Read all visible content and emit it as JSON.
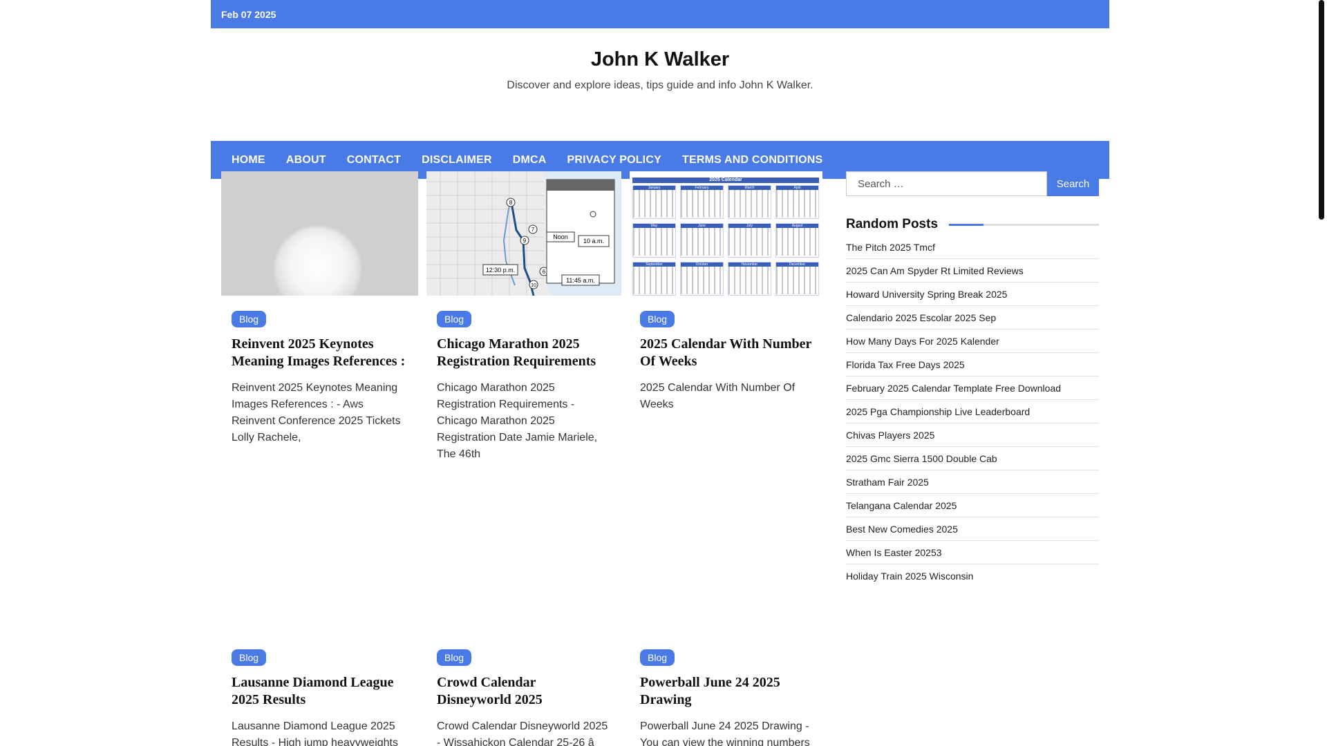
{
  "topbar": {
    "date": "Feb 07 2025"
  },
  "site": {
    "title": "John K Walker",
    "description": "Discover and explore ideas, tips guide and info John K Walker."
  },
  "nav": [
    "HOME",
    "ABOUT",
    "CONTACT",
    "DISCLAIMER",
    "DMCA",
    "PRIVACY POLICY",
    "TERMS AND CONDITIONS"
  ],
  "posts": [
    {
      "category": "Blog",
      "title": "Reinvent 2025 Keynotes Meaning Images References :",
      "excerpt": "Reinvent 2025 Keynotes Meaning Images References : - Aws Reinvent Conference 2025 Tickets Lolly Rachele,"
    },
    {
      "category": "Blog",
      "title": "Chicago Marathon 2025 Registration Requirements",
      "excerpt": "Chicago Marathon 2025 Registration Requirements - Chicago Marathon 2025 Registration Date Jamie Mariele, The 46th"
    },
    {
      "category": "Blog",
      "title": "2025 Calendar With Number Of Weeks",
      "excerpt": "2025 Calendar With Number Of Weeks"
    },
    {
      "category": "Blog",
      "title": "Lausanne Diamond League 2025 Results",
      "excerpt": "Lausanne Diamond League 2025 Results - High jump heavyweights"
    },
    {
      "category": "Blog",
      "title": "Crowd Calendar Disneyworld 2025",
      "excerpt": "Crowd Calendar Disneyworld 2025 - Wissahickon Calendar 25-26 â"
    },
    {
      "category": "Blog",
      "title": "Powerball June 24 2025 Drawing",
      "excerpt": "Powerball June 24 2025 Drawing - You can view the winning numbers"
    }
  ],
  "map_labels": {
    "stops": [
      "8",
      "7",
      "9",
      "6",
      "10"
    ],
    "times": [
      "Noon",
      "10 a.m.",
      "12:30 p.m.",
      "11:45 a.m."
    ]
  },
  "calendar_thumb": {
    "title": "2025 Calendar",
    "months": [
      "January",
      "February",
      "March",
      "April",
      "May",
      "June",
      "July",
      "August",
      "September",
      "October",
      "November",
      "December"
    ]
  },
  "search": {
    "placeholder": "Search …",
    "button": "Search"
  },
  "random_posts": {
    "title": "Random Posts",
    "items": [
      "The Pitch 2025 Tmcf",
      "2025 Can Am Spyder Rt Limited Reviews",
      "Howard University Spring Break 2025",
      "Calendario 2025 Escolar 2025 Sep",
      "How Many Days For 2025 Kalender",
      "Florida Tax Free Days 2025",
      "February 2025 Calendar Template Free Download",
      "2025 Pga Championship Live Leaderboard",
      "Chivas Players 2025",
      "2025 Gmc Sierra 1500 Double Cab",
      "Stratham Fair 2025",
      "Telangana Calendar 2025",
      "Best New Comedies 2025",
      "When Is Easter 20253",
      "Holiday Train 2025 Wisconsin"
    ]
  },
  "colors": {
    "accent": "#4a7ae6"
  }
}
